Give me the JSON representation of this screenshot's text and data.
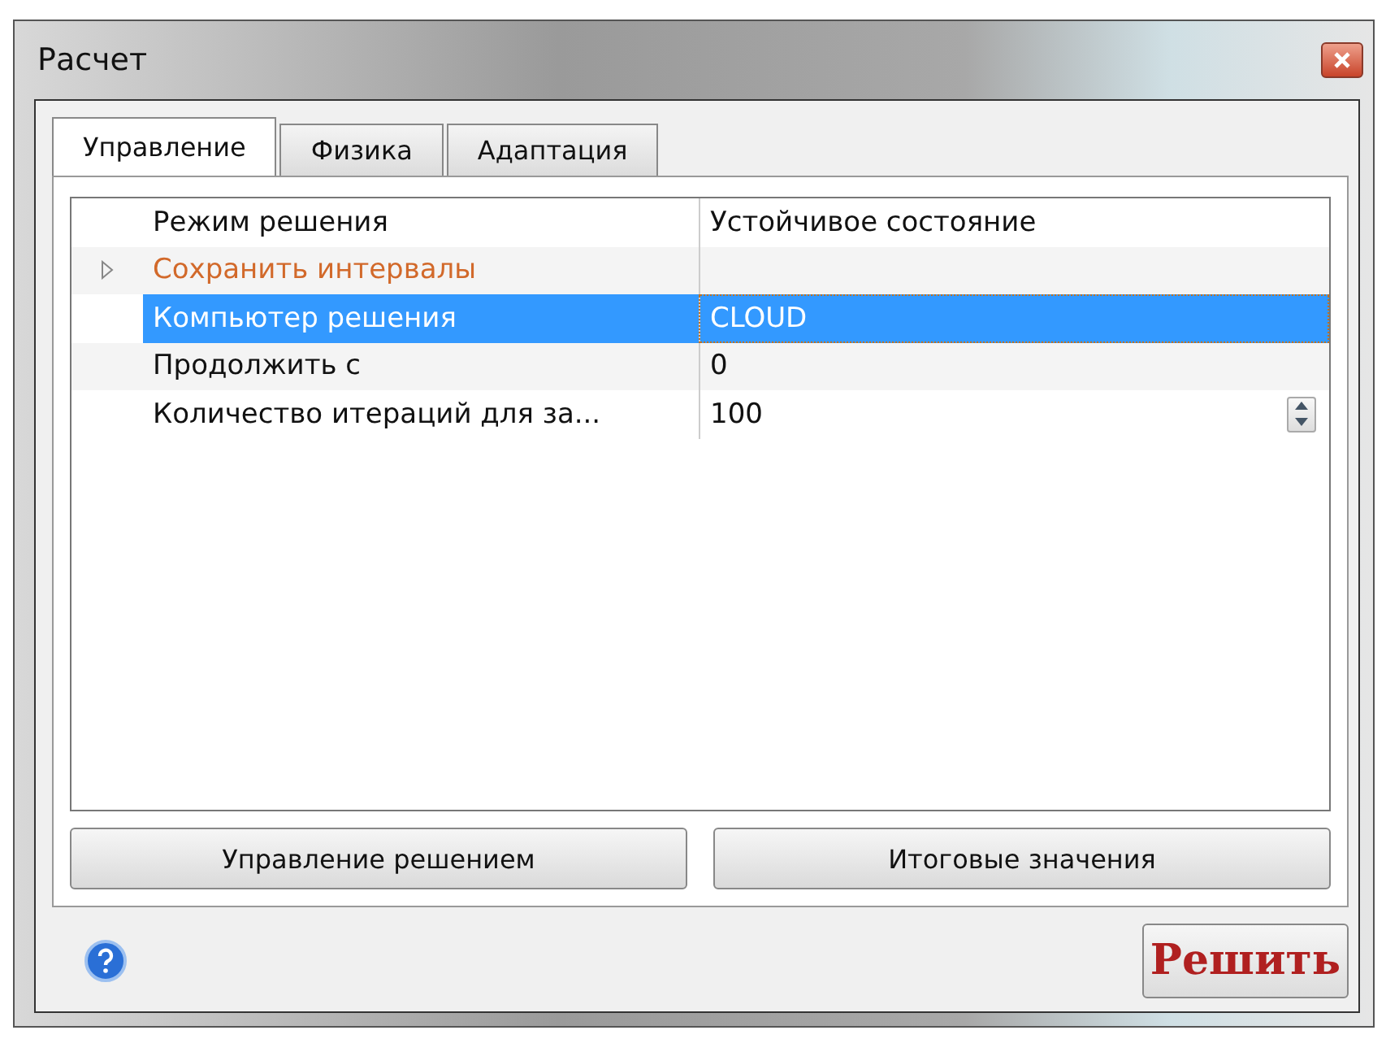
{
  "window": {
    "title": "Расчет"
  },
  "tabs": [
    {
      "label": "Управление",
      "selected": true
    },
    {
      "label": "Физика",
      "selected": false
    },
    {
      "label": "Адаптация",
      "selected": false
    }
  ],
  "properties": [
    {
      "kind": "value",
      "name": "Режим решения",
      "value": "Устойчивое состояние",
      "selected": false
    },
    {
      "kind": "group",
      "name": "Сохранить интервалы",
      "expanded": false,
      "selected": false
    },
    {
      "kind": "value",
      "name": "Компьютер решения",
      "value": "CLOUD",
      "selected": true
    },
    {
      "kind": "value",
      "name": "Продолжить с",
      "value": "0",
      "selected": false
    },
    {
      "kind": "spin",
      "name": "Количество итераций для за...",
      "value": "100",
      "selected": false
    }
  ],
  "buttons": [
    "Управление решением",
    "Итоговые значения"
  ],
  "solve_button": "Решить"
}
